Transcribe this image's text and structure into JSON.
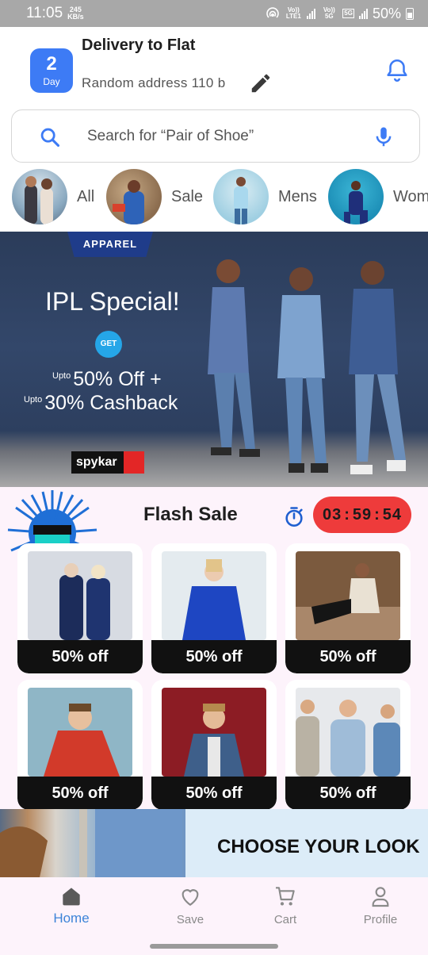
{
  "status_bar": {
    "time": "11:05",
    "net_speed": "245",
    "net_unit": "KB/s",
    "sim1": "Vo)) LTE1",
    "sim2": "Vo)) 5G",
    "net_5g": "5G",
    "battery": "50%"
  },
  "header": {
    "day_number": "2",
    "day_label": "Day",
    "delivery_title": "Delivery to Flat",
    "address": "Random address 110 b"
  },
  "search": {
    "placeholder": "Search for “Pair of Shoe”"
  },
  "categories": [
    {
      "label": "All"
    },
    {
      "label": "Sale"
    },
    {
      "label": "Mens"
    },
    {
      "label": "Wom"
    }
  ],
  "banner": {
    "tag": "APPAREL",
    "title": "IPL Special!",
    "get": "GET",
    "offer1_prefix": "Upto",
    "offer1": "50% Off +",
    "offer2_prefix": "Upto",
    "offer2": "30% Cashback",
    "brand": "spykar"
  },
  "flash_sale": {
    "title": "Flash Sale",
    "timer": {
      "h": "03",
      "m": "59",
      "s": "54"
    },
    "cards": [
      {
        "discount": "50% off"
      },
      {
        "discount": "50% off"
      },
      {
        "discount": "50% off"
      },
      {
        "discount": "50% off"
      },
      {
        "discount": "50% off"
      },
      {
        "discount": "50% off"
      }
    ]
  },
  "promo": {
    "title": "CHOOSE YOUR LOOK"
  },
  "bottom_nav": {
    "items": [
      {
        "label": "Home",
        "active": true
      },
      {
        "label": "Save",
        "active": false
      },
      {
        "label": "Cart",
        "active": false
      },
      {
        "label": "Profile",
        "active": false
      }
    ]
  },
  "colors": {
    "accent": "#3d7bf5",
    "nav_active": "#3d84d8",
    "timer_bg": "#ee3b3b",
    "flash_bg": "#fdf3fb"
  }
}
